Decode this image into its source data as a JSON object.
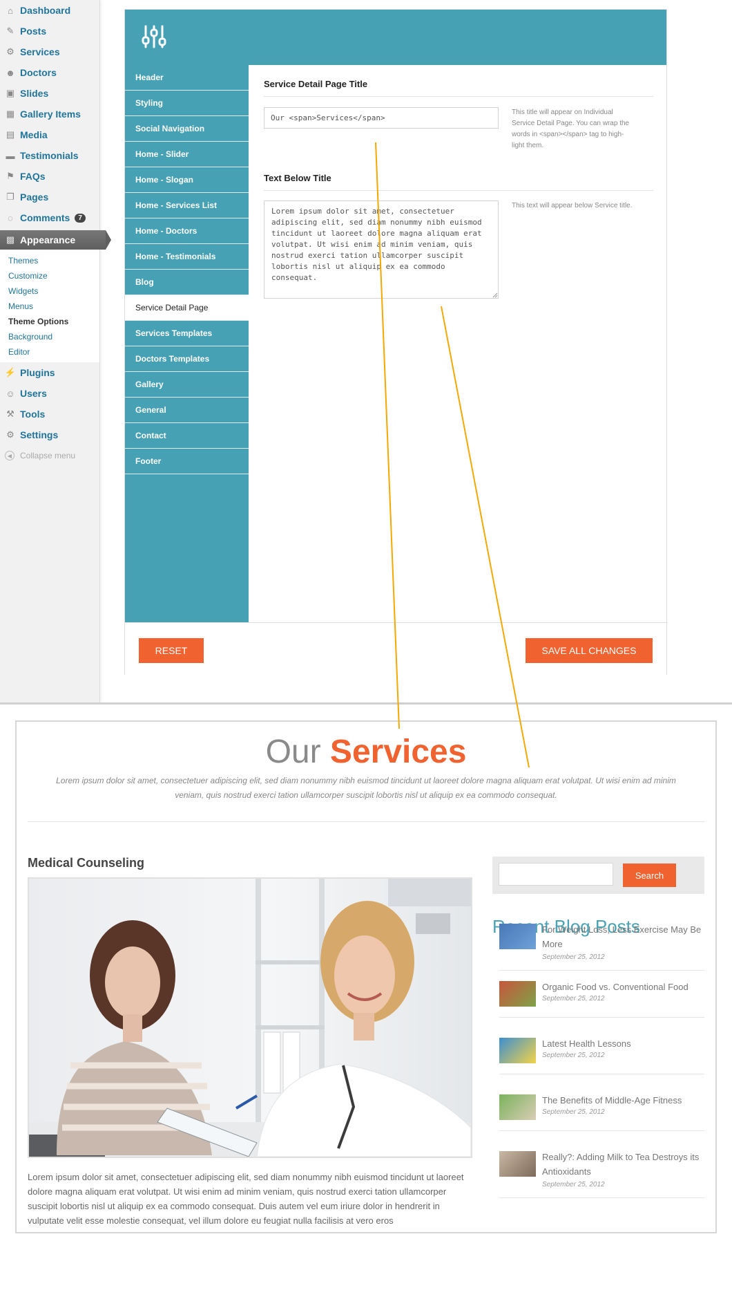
{
  "wp_menu": {
    "items_top": [
      {
        "label": "Dashboard",
        "icon": "dashboard-icon",
        "glyph": "⌂"
      },
      {
        "label": "Posts",
        "icon": "pin-icon",
        "glyph": "✎"
      },
      {
        "label": "Services",
        "icon": "gear-icon",
        "glyph": "⚙"
      },
      {
        "label": "Doctors",
        "icon": "users-icon",
        "glyph": "☻"
      },
      {
        "label": "Slides",
        "icon": "image-icon",
        "glyph": "▣"
      },
      {
        "label": "Gallery Items",
        "icon": "grid-icon",
        "glyph": "▦"
      },
      {
        "label": "Media",
        "icon": "media-icon",
        "glyph": "▤"
      },
      {
        "label": "Testimonials",
        "icon": "speech-bubble-icon",
        "glyph": "▬"
      },
      {
        "label": "FAQs",
        "icon": "flag-icon",
        "glyph": "⚑"
      },
      {
        "label": "Pages",
        "icon": "pages-icon",
        "glyph": "❐"
      },
      {
        "label": "Comments",
        "icon": "comment-icon",
        "glyph": "◌",
        "badge": "7"
      }
    ],
    "active": {
      "label": "Appearance",
      "icon": "appearance-icon",
      "glyph": "▩"
    },
    "submenu": [
      "Themes",
      "Customize",
      "Widgets",
      "Menus",
      "Theme Options",
      "Background",
      "Editor"
    ],
    "submenu_current": "Theme Options",
    "items_bottom": [
      {
        "label": "Plugins",
        "icon": "plug-icon",
        "glyph": "⚡"
      },
      {
        "label": "Users",
        "icon": "user-icon",
        "glyph": "☺"
      },
      {
        "label": "Tools",
        "icon": "wrench-icon",
        "glyph": "⚒"
      },
      {
        "label": "Settings",
        "icon": "settings-icon",
        "glyph": "⚙"
      }
    ],
    "collapse": "Collapse menu"
  },
  "options": {
    "logo_icon": "sliders-icon",
    "nav": [
      "Header",
      "Styling",
      "Social Navigation",
      "Home - Slider",
      "Home - Slogan",
      "Home - Services List",
      "Home - Doctors",
      "Home - Testimonials",
      "Blog",
      "Service Detail Page",
      "Services Templates",
      "Doctors Templates",
      "Gallery",
      "General",
      "Contact",
      "Footer"
    ],
    "nav_current": "Service Detail Page",
    "field1": {
      "title": "Service Detail Page Title",
      "value": "Our <span>Services</span>",
      "desc": "This title will appear on Individual Service Detail Page. You can wrap the words in <span></span> tag to high-light them."
    },
    "field2": {
      "title": "Text Below Title",
      "value": "Lorem ipsum dolor sit amet, consectetuer adipiscing elit, sed diam nonummy nibh euismod tincidunt ut laoreet dolore magna aliquam erat volutpat. Ut wisi enim ad minim veniam, quis nostrud exerci tation ullamcorper suscipit lobortis nisl ut aliquip ex ea commodo consequat.",
      "desc": "This text will appear below Service title."
    },
    "reset_label": "RESET",
    "save_label": "SAVE ALL CHANGES"
  },
  "site": {
    "heading_plain": "Our",
    "heading_highlight": "Services",
    "intro": "Lorem ipsum dolor sit amet, consectetuer adipiscing elit, sed diam nonummy nibh euismod tincidunt ut laoreet dolore magna aliquam erat volutpat. Ut wisi enim ad minim veniam, quis nostrud exerci tation ullamcorper suscipit lobortis nisl ut aliquip ex ea commodo consequat.",
    "service_title": "Medical Counseling",
    "service_text": "Lorem ipsum dolor sit amet, consectetuer adipiscing elit, sed diam nonummy nibh euismod tincidunt ut laoreet dolore magna aliquam erat volutpat. Ut wisi enim ad minim veniam, quis nostrud exerci tation ullamcorper suscipit lobortis nisl ut aliquip ex ea commodo consequat. Duis autem vel eum iriure dolor in hendrerit in vulputate velit esse molestie consequat, vel illum dolore eu feugiat nulla facilisis at vero eros",
    "search_label": "Search",
    "recent_title": "Recent Blog Posts",
    "posts": [
      {
        "title": "For Weight Loss, Less Exercise May Be More",
        "date": "September 25, 2012"
      },
      {
        "title": "Organic Food vs. Conventional Food",
        "date": "September 25, 2012"
      },
      {
        "title": "Latest Health Lessons",
        "date": "September 25, 2012"
      },
      {
        "title": "The Benefits of Middle-Age Fitness",
        "date": "September 25, 2012"
      },
      {
        "title": "Really?: Adding Milk to Tea Destroys its Antioxidants",
        "date": "September 25, 2012"
      }
    ]
  },
  "colors": {
    "teal": "#47a1b4",
    "orange": "#f0622f",
    "connector": "#f5a800",
    "wp_link": "#21759b"
  }
}
